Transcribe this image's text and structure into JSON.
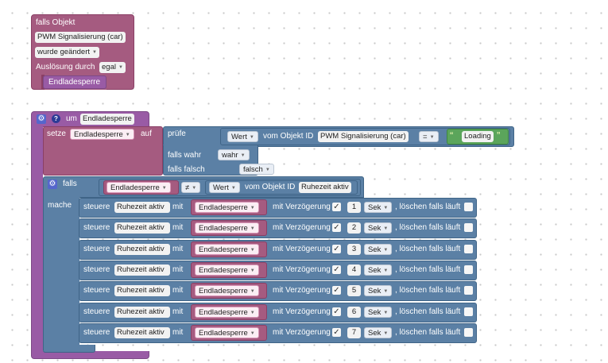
{
  "colors": {
    "trigger": "#a55b80",
    "function": "#995ba5",
    "setBlock": "#a55b80",
    "control": "#5b80a5",
    "value": "#5ba55b",
    "highlight": "#d15c8a"
  },
  "trigger": {
    "title": "falls Objekt",
    "object": "PWM Signalisierung (car)",
    "condition": "wurde geändert",
    "trigger_label": "Auslösung durch",
    "trigger_value": "egal",
    "statement": "Endladesperre"
  },
  "func": {
    "prefix": "um",
    "name": "Endladesperre"
  },
  "setblock": {
    "label": "setze",
    "variable": "Endladesperre",
    "to": "auf",
    "check": "prüfe",
    "when_true_label": "falls wahr",
    "when_true_value": "wahr",
    "when_false_label": "falls falsch",
    "when_false_value": "falsch"
  },
  "compare1": {
    "attr": "Wert",
    "from_label": "vom Objekt ID",
    "object": "PWM Signalisierung (car)",
    "op": "=",
    "quote_open": "“",
    "text": "Loading",
    "quote_close": "”"
  },
  "ifblock": {
    "label": "falls",
    "do_label": "mache",
    "left": "Endladesperre",
    "op": "≠",
    "attr": "Wert",
    "from_label": "vom Objekt ID",
    "object": "Ruhezeit aktiv"
  },
  "control_rows": [
    {
      "control": "steuere",
      "object": "Ruhezeit aktiv",
      "with": "mit",
      "value": "Endladesperre",
      "delay_label": "mit Verzögerung",
      "delay": "1",
      "unit": "Sek",
      "clear_label": ", löschen falls läuft"
    },
    {
      "control": "steuere",
      "object": "Ruhezeit aktiv",
      "with": "mit",
      "value": "Endladesperre",
      "delay_label": "mit Verzögerung",
      "delay": "2",
      "unit": "Sek",
      "clear_label": ", löschen falls läuft"
    },
    {
      "control": "steuere",
      "object": "Ruhezeit aktiv",
      "with": "mit",
      "value": "Endladesperre",
      "delay_label": "mit Verzögerung",
      "delay": "3",
      "unit": "Sek",
      "clear_label": ", löschen falls läuft"
    },
    {
      "control": "steuere",
      "object": "Ruhezeit aktiv",
      "with": "mit",
      "value": "Endladesperre",
      "delay_label": "mit Verzögerung",
      "delay": "4",
      "unit": "Sek",
      "clear_label": ", löschen falls läuft"
    },
    {
      "control": "steuere",
      "object": "Ruhezeit aktiv",
      "with": "mit",
      "value": "Endladesperre",
      "delay_label": "mit Verzögerung",
      "delay": "5",
      "unit": "Sek",
      "clear_label": ", löschen falls läuft"
    },
    {
      "control": "steuere",
      "object": "Ruhezeit aktiv",
      "with": "mit",
      "value": "Endladesperre",
      "delay_label": "mit Verzögerung",
      "delay": "6",
      "unit": "Sek",
      "clear_label": ", löschen falls läuft"
    },
    {
      "control": "steuere",
      "object": "Ruhezeit aktiv",
      "with": "mit",
      "value": "Endladesperre",
      "delay_label": "mit Verzögerung",
      "delay": "7",
      "unit": "Sek",
      "clear_label": ", löschen falls läuft"
    }
  ]
}
